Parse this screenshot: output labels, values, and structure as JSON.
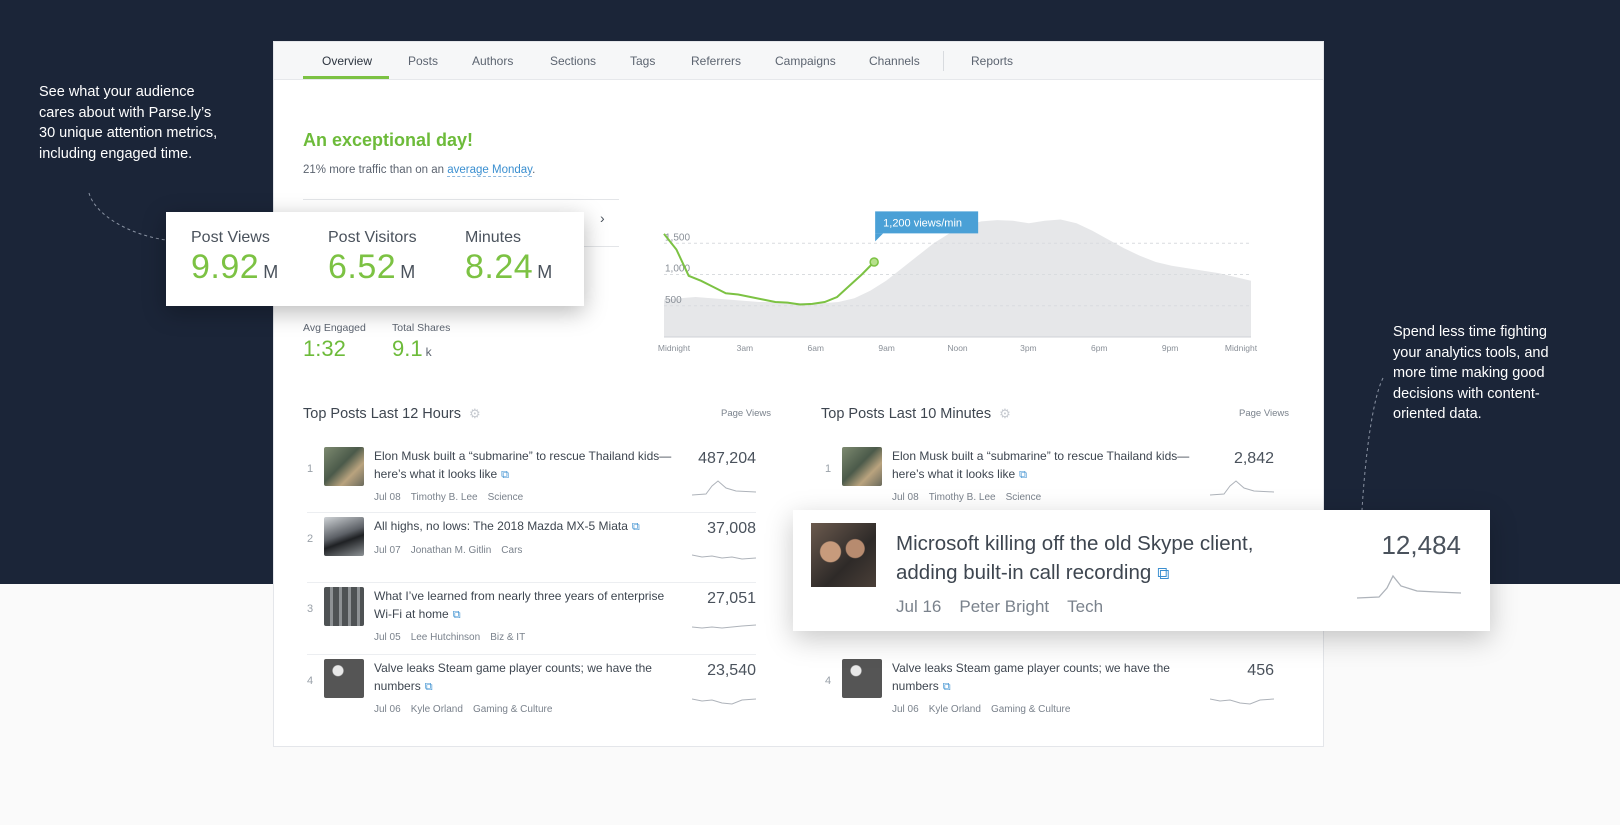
{
  "left_caption": "See what your audience cares about with Parse.ly’s 30 unique attention metrics, including engaged time.",
  "right_caption": "Spend less time fighting your analytics tools, and more time making good decisions with content-oriented data.",
  "tabs": [
    {
      "label": "Overview",
      "active": true
    },
    {
      "label": "Posts"
    },
    {
      "label": "Authors"
    },
    {
      "label": "Sections"
    },
    {
      "label": "Tags"
    },
    {
      "label": "Referrers"
    },
    {
      "label": "Campaigns"
    },
    {
      "label": "Channels"
    },
    {
      "label": "Reports"
    }
  ],
  "summary": {
    "headline": "An exceptional day!",
    "sub_prefix": "21% more traffic than on an ",
    "sub_link": "average Monday",
    "sub_suffix": "."
  },
  "metrics": [
    {
      "label": "Post Views",
      "value": "9.92",
      "unit": "M"
    },
    {
      "label": "Post Visitors",
      "value": "6.52",
      "unit": "M"
    },
    {
      "label": "Minutes",
      "value": "8.24",
      "unit": "M"
    }
  ],
  "small_metrics": [
    {
      "label": "Avg Engaged",
      "value": "1:32",
      "unit": ""
    },
    {
      "label": "Total Shares",
      "value": "9.1",
      "unit": "k"
    }
  ],
  "chart_data": {
    "type": "area",
    "title": "",
    "xlabel": "",
    "ylabel": "",
    "x_ticks": [
      "Midnight",
      "3am",
      "6am",
      "9am",
      "Noon",
      "3pm",
      "6pm",
      "9pm",
      "Midnight"
    ],
    "y_ticks": [
      500,
      1000,
      1500
    ],
    "ylim": [
      0,
      2000
    ],
    "tooltip": "1,200 views/min",
    "series": [
      {
        "values": [
          1650,
          1400,
          980,
          900,
          800,
          700,
          680,
          640,
          600,
          560,
          550,
          520,
          530,
          560,
          640,
          820,
          1000,
          1200
        ]
      },
      {
        "values": [
          600,
          620,
          640,
          620,
          600,
          580,
          560,
          560,
          550,
          540,
          540,
          560,
          620,
          740,
          900,
          1100,
          1300,
          1500,
          1660,
          1780,
          1850,
          1870,
          1860,
          1820,
          1860,
          1880,
          1820,
          1700,
          1560,
          1420,
          1300,
          1200,
          1140,
          1100,
          1060,
          1020,
          960,
          900
        ]
      }
    ],
    "grid": true,
    "accent": "#7cc243",
    "fill": "#e6e7e9"
  },
  "left_list": {
    "title": "Top Posts Last 12 Hours",
    "col_label": "Page Views",
    "posts": [
      {
        "rank": "1",
        "title": "Elon Musk built a “submarine” to rescue Thailand kids—here’s what it looks like",
        "date": "Jul 08",
        "author": "Timothy B. Lee",
        "section": "Science",
        "views": "487,204"
      },
      {
        "rank": "2",
        "title": "All highs, no lows: The 2018 Mazda MX-5 Miata",
        "date": "Jul 07",
        "author": "Jonathan M. Gitlin",
        "section": "Cars",
        "views": "37,008"
      },
      {
        "rank": "3",
        "title": "What I’ve learned from nearly three years of enterprise Wi-Fi at home",
        "date": "Jul 05",
        "author": "Lee Hutchinson",
        "section": "Biz & IT",
        "views": "27,051"
      },
      {
        "rank": "4",
        "title": "Valve leaks Steam game player counts; we have the numbers",
        "date": "Jul 06",
        "author": "Kyle Orland",
        "section": "Gaming & Culture",
        "views": "23,540"
      }
    ]
  },
  "right_list": {
    "title": "Top Posts Last 10 Minutes",
    "col_label": "Page Views",
    "posts": [
      {
        "rank": "1",
        "title": "Elon Musk built a “submarine” to rescue Thailand kids—here’s what it looks like",
        "date": "Jul 08",
        "author": "Timothy B. Lee",
        "section": "Science",
        "views": "2,842"
      },
      {
        "rank": "4",
        "title": "Valve leaks Steam game player counts; we have the numbers",
        "date": "Jul 06",
        "author": "Kyle Orland",
        "section": "Gaming & Culture",
        "views": "456"
      }
    ]
  },
  "featured": {
    "title": "Microsoft killing off the old Skype client, adding built-in call recording",
    "date": "Jul 16",
    "author": "Peter Bright",
    "section": "Tech",
    "views": "12,484"
  },
  "icons": {
    "gear": "gear-icon",
    "external": "external-link-icon",
    "chevron": "chevron-right-icon"
  }
}
